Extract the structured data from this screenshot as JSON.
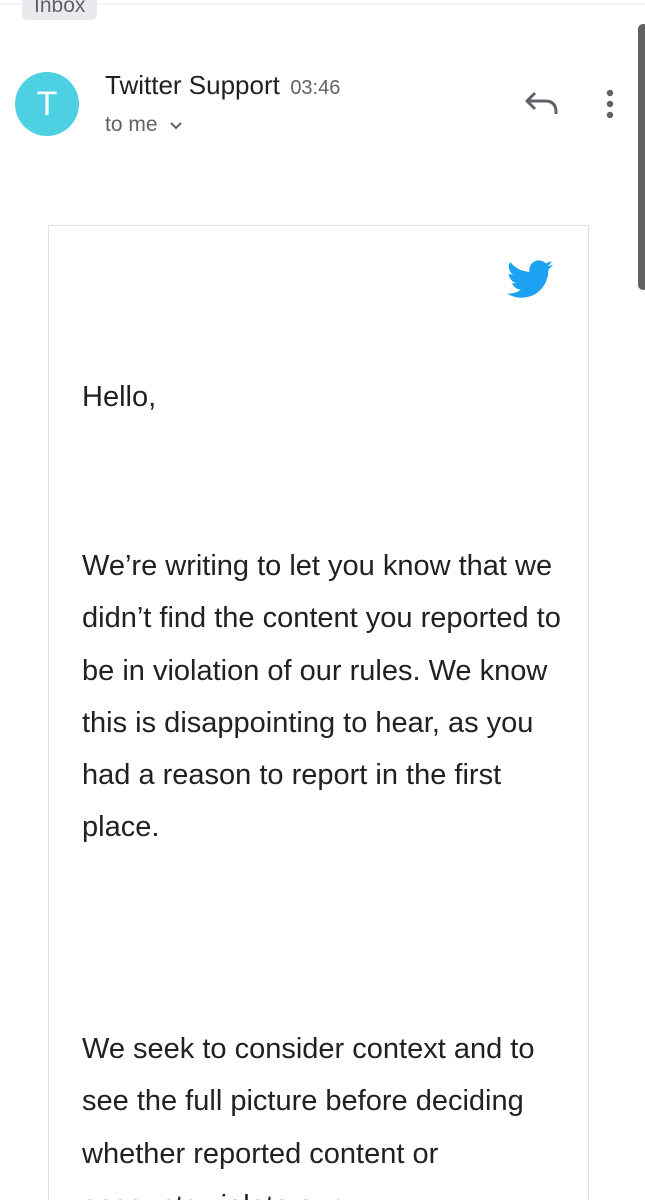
{
  "label_chip": {
    "text": "Inbox"
  },
  "message": {
    "sender_initial": "T",
    "sender_name": "Twitter Support",
    "time": "03:46",
    "recipient": "to me"
  },
  "colors": {
    "avatar": "#4dd0e1",
    "twitter_blue": "#1da1f2",
    "icon_gray": "#5f6368"
  },
  "actions": {
    "reply_icon": "reply-arrow-icon",
    "more_icon": "vertical-ellipsis-icon"
  },
  "email_body": {
    "logo": "twitter-bird-icon",
    "greeting": "Hello,",
    "paragraph_1": "We’re writing to let you know that we didn’t find the content you reported to be in violation of our rules. We know this is disappointing to hear, as you had a reason to report in the first place.",
    "paragraph_2": "We seek to consider context and to see the full picture before deciding whether reported content or accounts violate our"
  }
}
